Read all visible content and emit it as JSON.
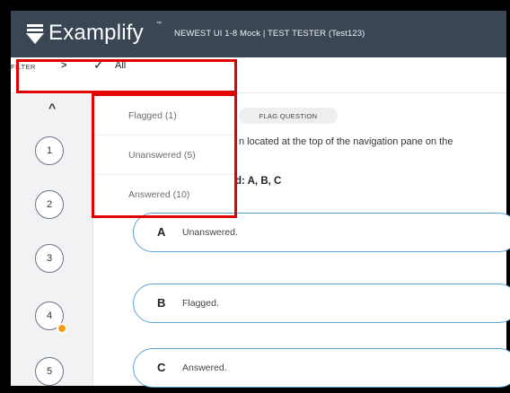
{
  "header": {
    "logo_text": "Examplify",
    "logo_tm": "™",
    "exam_title": "NEWEST UI 1-8 Mock | TEST TESTER (Test123)"
  },
  "filter": {
    "label": "FILTER",
    "chevron": ">",
    "check": "✓",
    "selected": "All",
    "options": [
      "Flagged (1)",
      "Unanswered (5)",
      "Answered (10)"
    ]
  },
  "navigation": {
    "up_arrow": "^",
    "questions": [
      "1",
      "2",
      "3",
      "4",
      "5"
    ],
    "flagged_question": "4"
  },
  "question": {
    "flag_button": "FLAG QUESTION",
    "text": "n located at the top of the navigation pane on the",
    "answer_hint": "d: A, B, C"
  },
  "answers": [
    {
      "letter": "A",
      "text": "Unanswered."
    },
    {
      "letter": "B",
      "text": "Flagged."
    },
    {
      "letter": "C",
      "text": "Answered."
    }
  ],
  "colors": {
    "header_bg": "#3a4654",
    "highlight_red": "#e00000",
    "answer_border": "#57a6d8",
    "flag_dot": "#f39c12"
  },
  "icons": {
    "logo": "download-arrow-icon",
    "filter_chevron": "chevron-right-icon",
    "check": "check-icon",
    "nav_up": "chevron-up-icon",
    "flag": "flag-badge-icon"
  }
}
